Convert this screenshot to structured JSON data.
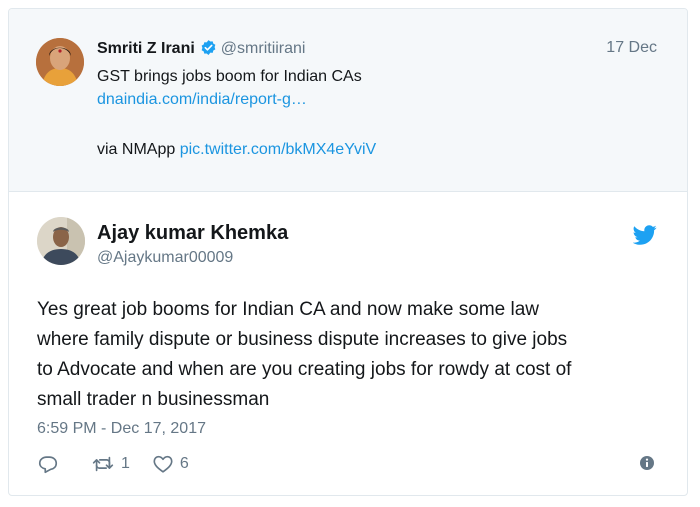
{
  "parent_tweet": {
    "author_name": "Smriti Z Irani",
    "author_handle": "@smritiirani",
    "date": "17 Dec",
    "text_line1": "GST brings jobs boom for Indian CAs",
    "link1": "dnaindia.com/india/report-g…",
    "via_prefix": "via NMApp ",
    "link2": "pic.twitter.com/bkMX4eYviV"
  },
  "tweet": {
    "author_name": "Ajay kumar Khemka",
    "author_handle": "@Ajaykumar00009",
    "text_lines": [
      "Yes great job booms for Indian CA and now make some law",
      "where family dispute or business dispute increases to give jobs",
      "to Advocate and when are you creating jobs for rowdy at cost of",
      "small trader n businessman"
    ],
    "timestamp": "6:59 PM - Dec 17, 2017",
    "retweet_count": "1",
    "like_count": "6"
  },
  "icons": {
    "verified": "verified-badge-icon",
    "brand": "twitter-bird-icon",
    "reply": "reply-icon",
    "retweet": "retweet-icon",
    "like": "heart-icon",
    "info": "info-icon"
  },
  "colors": {
    "twitter_blue": "#1da1f2",
    "link": "#1b95e0",
    "text": "#14171a",
    "secondary_text": "#657786",
    "parent_background": "#f5f8fa",
    "border": "#e1e8ed"
  }
}
